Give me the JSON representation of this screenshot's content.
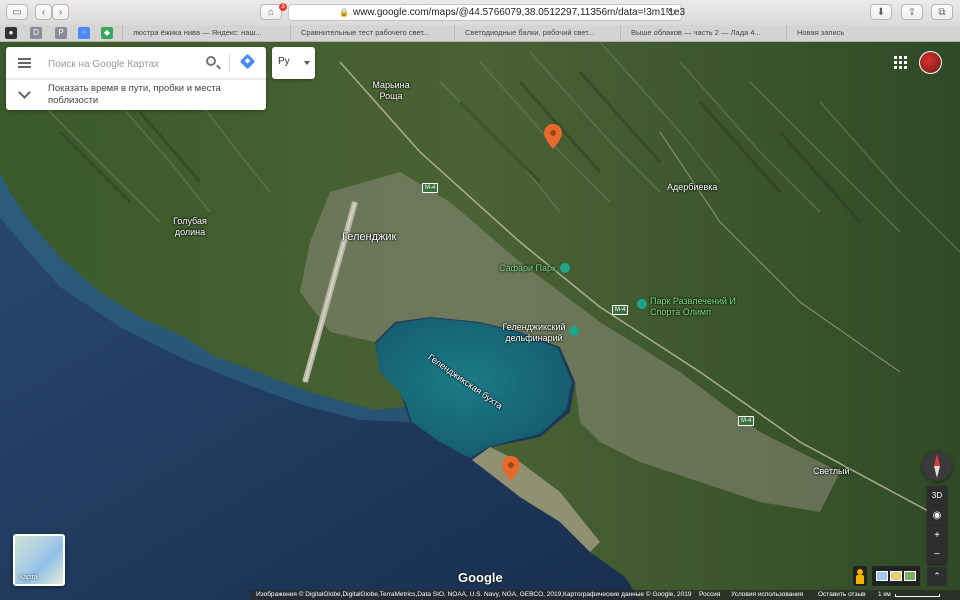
{
  "browser": {
    "url": "www.google.com/maps/@44.5766079,38.0512297,11356m/data=!3m1!1e3",
    "notification_count": "3",
    "favicons": [
      "D",
      "P"
    ],
    "tabs": [
      "люстра ёжика нива — Яндекс: наш...",
      "Сравнительные тест рабочего свет...",
      "Светодиодные балки, рабочий свет...",
      "Выше облаков — часть 2 — Лада 4...",
      "Новая запись"
    ]
  },
  "search": {
    "placeholder": "Поиск на Google Картах",
    "commute_text": "Показать время в пути, пробки и места поблизости",
    "language": "Ру"
  },
  "map": {
    "labels": {
      "marina_roshcha": "Марьина Роща",
      "gelendzhik": "Геленджик",
      "golubaya_dolina": "Голубая долина",
      "aderbievka": "Адербиевка",
      "safari_park": "Сафари Парк",
      "park_olimp": "Парк Развлечений И Спорта Олимп",
      "dolphinarium": "Геленджикский дельфинарий",
      "bay": "Геленджикская бухта",
      "svetly": "Светлый"
    },
    "roads": [
      "M-4",
      "M-4",
      "M-4"
    ]
  },
  "controls": {
    "thumbnail_label": "Карта",
    "tilt_label": "3D",
    "zoom_in": "+",
    "zoom_out": "−",
    "expand": "⌃"
  },
  "google_logo": "Google",
  "footer": {
    "attribution": "Изображения © DigitalGlobe,DigitalGlobe,TerraMetrics,Data SIO, NOAA, U.S. Navy, NGA, GEBCO, 2019,Картографические данные © Google, 2019",
    "country": "Россия",
    "terms": "Условия использования",
    "feedback": "Оставить отзыв",
    "scale": "1 км"
  },
  "colors": {
    "sea": "#1f3a5e",
    "bay": "#1b7d83",
    "land": "#3f5d2c",
    "pin": "#e8692c",
    "accent": "#4a8af4"
  }
}
